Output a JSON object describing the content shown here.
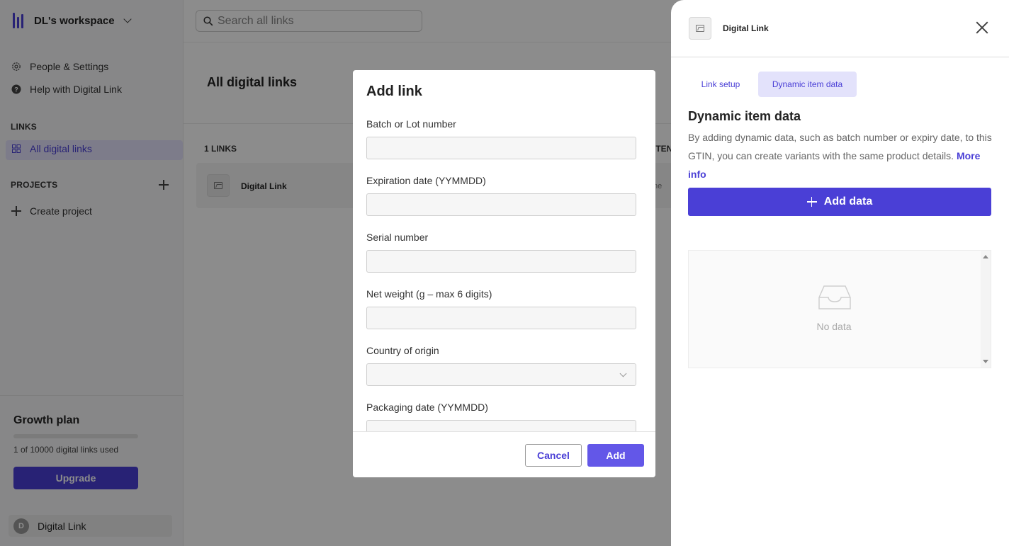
{
  "sidebar": {
    "workspace": "DL's workspace",
    "people_settings": "People & Settings",
    "help": "Help with Digital Link",
    "links_section": "LINKS",
    "all_links": "All digital links",
    "projects_section": "PROJECTS",
    "create_project": "Create project",
    "plan": {
      "title": "Growth plan",
      "usage_text": "1 of 10000 digital links used",
      "usage_fraction": 0.0001,
      "upgrade_label": "Upgrade"
    },
    "user": {
      "initial": "D",
      "name": "Digital Link"
    }
  },
  "topbar": {
    "search_placeholder": "Search all links"
  },
  "main": {
    "title": "All digital links",
    "count_label": "1 LINKS",
    "column_partial": "ITEN",
    "rows": [
      {
        "name": "Digital Link",
        "trail": "ne"
      }
    ]
  },
  "drawer": {
    "title": "Digital Link",
    "tabs": [
      "Link setup",
      "Dynamic item data"
    ],
    "active_tab": "Dynamic item data",
    "section_title": "Dynamic item data",
    "description": "By adding dynamic data, such as batch number or expiry date, to this GTIN, you can create variants with the same product details.",
    "more_info": "More info",
    "add_data_label": "Add data",
    "empty_text": "No data"
  },
  "modal": {
    "title": "Add link",
    "fields": [
      {
        "label": "Batch or Lot number",
        "value": ""
      },
      {
        "label": "Expiration date (YYMMDD)",
        "value": ""
      },
      {
        "label": "Serial number",
        "value": ""
      },
      {
        "label": "Net weight (g – max 6 digits)",
        "value": ""
      },
      {
        "label": "Country of origin",
        "value": ""
      },
      {
        "label": "Packaging date (YYMMDD)",
        "value": ""
      }
    ],
    "cancel_label": "Cancel",
    "add_label": "Add"
  },
  "colors": {
    "accent": "#4a3fd6",
    "accent_light": "#e3e2fb",
    "add_button": "#6357e8"
  }
}
